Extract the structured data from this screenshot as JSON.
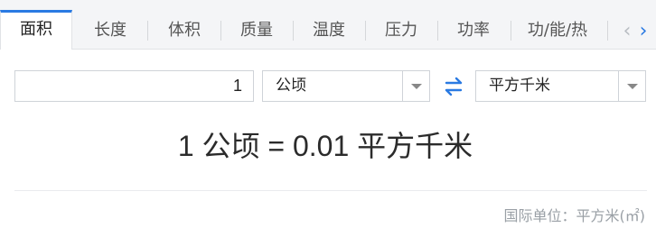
{
  "tabs": [
    {
      "label": "面积",
      "active": true
    },
    {
      "label": "长度",
      "active": false
    },
    {
      "label": "体积",
      "active": false
    },
    {
      "label": "质量",
      "active": false
    },
    {
      "label": "温度",
      "active": false
    },
    {
      "label": "压力",
      "active": false
    },
    {
      "label": "功率",
      "active": false
    },
    {
      "label": "功/能/热",
      "active": false
    }
  ],
  "nav": {
    "prev_icon": "chevron-left-icon",
    "next_icon": "chevron-right-icon"
  },
  "converter": {
    "input_value": "1",
    "from_unit": "公顷",
    "to_unit": "平方千米",
    "swap_icon": "swap-arrows-icon"
  },
  "result": {
    "text": "1 公顷 = 0.01 平方千米"
  },
  "si_unit": {
    "text": "国际单位：平方米(㎡)"
  },
  "colors": {
    "accent": "#2a7ae2",
    "tab_bg": "#f4f5f7",
    "muted_text": "#9aa0a6"
  }
}
